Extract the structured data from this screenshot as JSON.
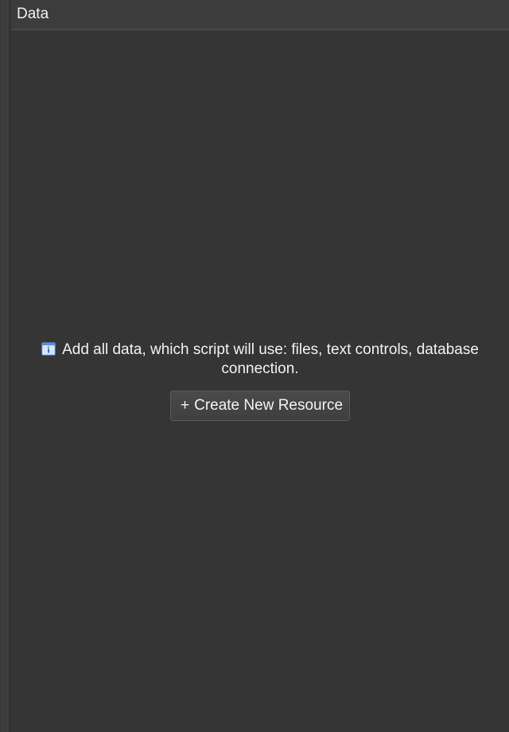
{
  "panel": {
    "title": "Data"
  },
  "empty_state": {
    "icon": "info-icon",
    "message": "Add all data, which script will use: files, text controls, database connection.",
    "button_plus": "+",
    "button_label": "Create New Resource"
  },
  "colors": {
    "background": "#353535",
    "header": "#3c3c3c",
    "button": "#444444",
    "text": "#f2f2f2"
  }
}
